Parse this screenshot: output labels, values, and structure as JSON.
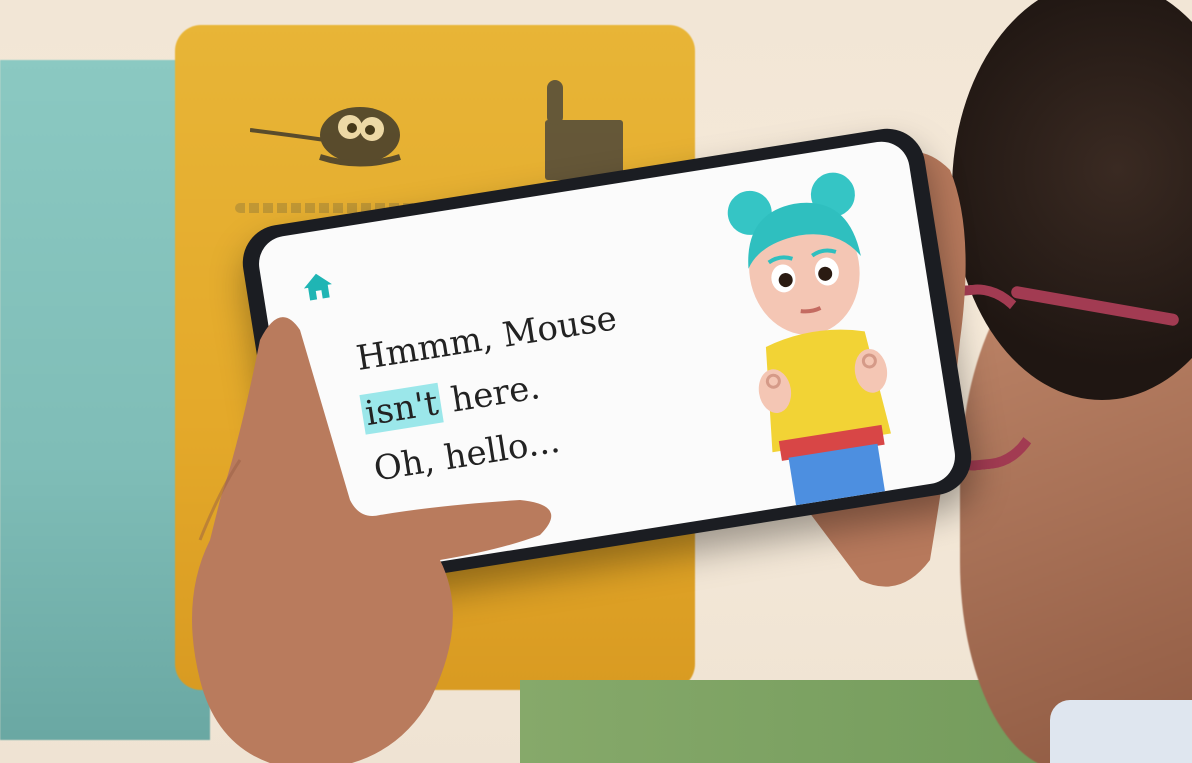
{
  "app": {
    "home_icon": "home-icon"
  },
  "story": {
    "line1": "Hmmm, Mouse",
    "line2_highlight": "isn't",
    "line2_rest": " here.",
    "line3": "Oh, hello..."
  },
  "colors": {
    "accent": "#1fb5b4",
    "highlight": "#9be7ea",
    "phone_body": "#1b1d22"
  }
}
